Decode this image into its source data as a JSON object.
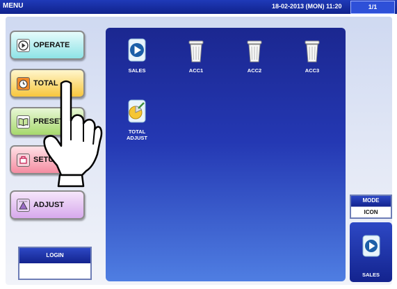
{
  "titlebar": {
    "menu": "MENU",
    "datetime": "18-02-2013 (MON)  11:20",
    "page": "1/1"
  },
  "sidebar": {
    "operate": {
      "label": "OPERATE",
      "icon": "play-icon"
    },
    "total": {
      "label": "TOTAL",
      "icon": "clock-icon"
    },
    "preset": {
      "label": "PRESET",
      "icon": "book-icon"
    },
    "setup": {
      "label": "SETUP",
      "icon": "setup-icon"
    },
    "adjust": {
      "label": "ADJUST",
      "icon": "scale-icon"
    }
  },
  "login": {
    "label": "LOGIN",
    "value": ""
  },
  "apps": [
    {
      "label": "SALES",
      "icon": "sales-play-icon"
    },
    {
      "label": "ACC1",
      "icon": "trash-can-icon"
    },
    {
      "label": "ACC2",
      "icon": "trash-can-icon"
    },
    {
      "label": "ACC3",
      "icon": "trash-can-icon"
    },
    {
      "label": "TOTAL\nADJUST",
      "icon": "pie-chart-icon"
    }
  ],
  "mode": {
    "label": "MODE",
    "value": "ICON"
  },
  "shortcut": {
    "label": "SALES",
    "icon": "sales-play-icon"
  },
  "colors": {
    "titlebar": "#10228c",
    "content_top": "#1b2790",
    "content_bottom": "#4f7ee2"
  }
}
